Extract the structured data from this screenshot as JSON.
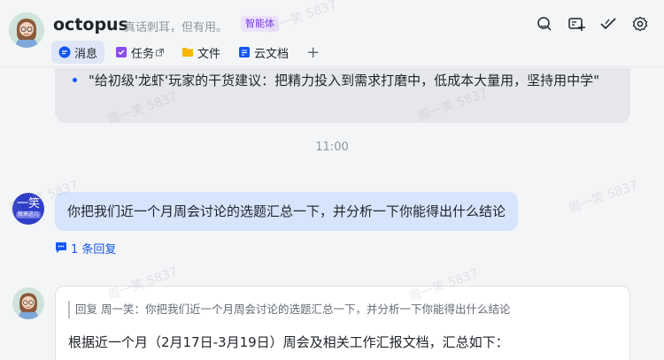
{
  "header": {
    "title": "octopus",
    "subtitle": "真话刺耳，但有用。",
    "badge": "智能体",
    "tabs": [
      {
        "label": "消息"
      },
      {
        "label": "任务"
      },
      {
        "label": "文件"
      },
      {
        "label": "云文档"
      }
    ],
    "add_tab": "+",
    "icons": [
      "search-icon",
      "add-chat-icon",
      "check-icon",
      "settings-icon"
    ]
  },
  "chat": {
    "prev_message": "\"给初级'龙虾'玩家的干货建议：把精力投入到需求打磨中，低成本大量用，坚持用中学\"",
    "time": "11:00",
    "user_avatar": {
      "line1": "一笑",
      "line2": "就来这儿"
    },
    "user_message": "你把我们近一个月周会讨论的选题汇总一下，并分析一下你能得出什么结论",
    "reply_count": "1 条回复",
    "bot_quote": "回复 周一笑：你把我们近一个月周会讨论的选题汇总一下，并分析一下你能得出什么结论",
    "bot_text": "根据近一个月（2月17日-3月19日）周会及相关工作汇报文档，汇总如下："
  },
  "watermark": "周一笑 5837",
  "colors": {
    "accent": "#1456f0",
    "user_bubble": "#d6e4fc",
    "badge_bg": "#ece2fe",
    "badge_text": "#7a35f0"
  }
}
